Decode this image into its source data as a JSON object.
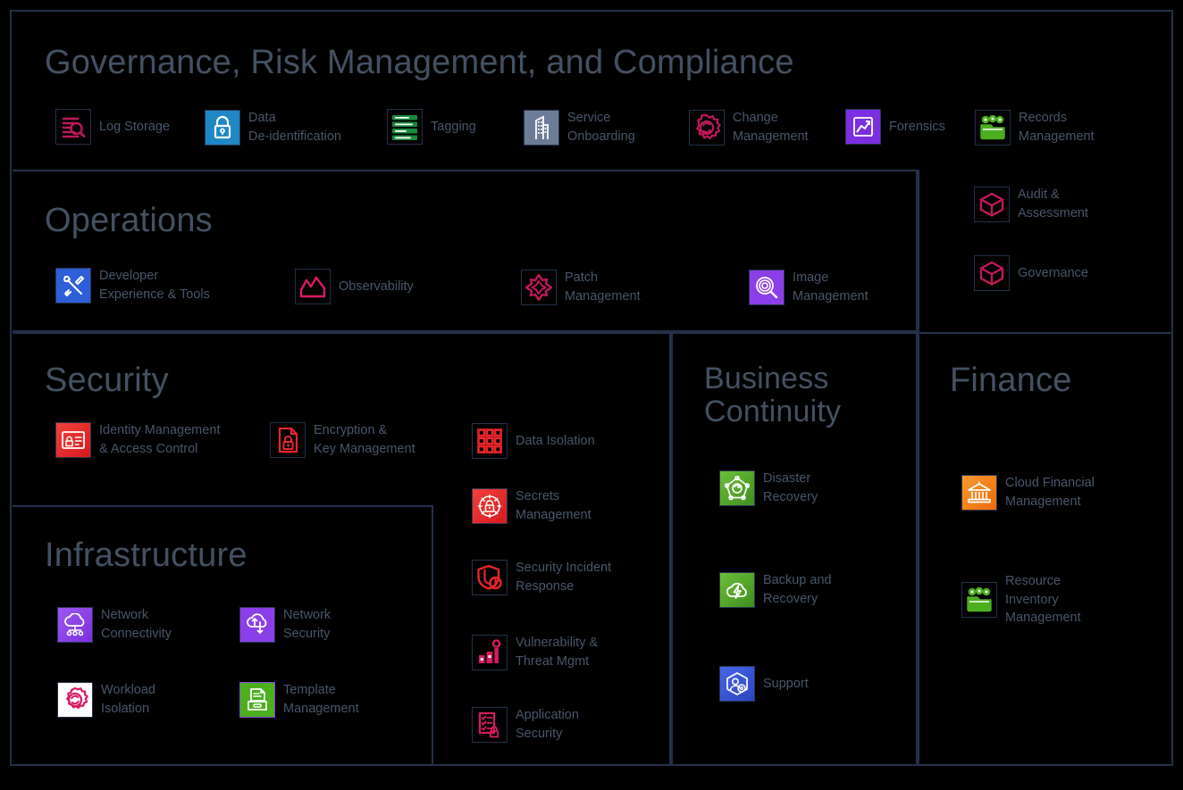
{
  "diagram": {
    "type": "cloud-operating-model-capability-map",
    "sections": [
      {
        "id": "grc",
        "title": "Governance, Risk Management, and Compliance",
        "items": [
          {
            "label": "Log Storage",
            "icon": "log-storage-icon",
            "color": "#C2185B",
            "style": "outline"
          },
          {
            "label": "Data\nDe-identification",
            "icon": "data-deidentification-icon",
            "color": "#1E88C7",
            "style": "filled"
          },
          {
            "label": "Tagging",
            "icon": "tagging-icon",
            "color": "#1B8A3C",
            "style": "outline"
          },
          {
            "label": "Service\nOnboarding",
            "icon": "service-onboarding-icon",
            "color": "#6B7C99",
            "style": "filled"
          },
          {
            "label": "Change\nManagement",
            "icon": "change-management-icon",
            "color": "#C2185B",
            "style": "outline"
          },
          {
            "label": "Forensics",
            "icon": "forensics-icon",
            "color": "#7B2FE0",
            "style": "filled"
          },
          {
            "label": "Records\nManagement",
            "icon": "records-management-icon",
            "color": "#4CAF1E",
            "style": "outline"
          }
        ]
      },
      {
        "id": "operations",
        "title": "Operations",
        "items": [
          {
            "label": "Developer\nExperience & Tools",
            "icon": "developer-tools-icon",
            "color": "#2E5FD9",
            "style": "filled"
          },
          {
            "label": "Observability",
            "icon": "observability-icon",
            "color": "#D81B60",
            "style": "outline"
          },
          {
            "label": "Patch\nManagement",
            "icon": "patch-management-icon",
            "color": "#C2185B",
            "style": "outline"
          },
          {
            "label": "Image\nManagement",
            "icon": "image-management-icon",
            "color": "#8A3FE8",
            "style": "filled"
          }
        ]
      },
      {
        "id": "grc-side",
        "title": "",
        "items": [
          {
            "label": "Audit &\nAssessment",
            "icon": "audit-assessment-icon",
            "color": "#C2185B",
            "style": "outline"
          },
          {
            "label": "Governance",
            "icon": "governance-icon",
            "color": "#C2185B",
            "style": "outline"
          }
        ]
      },
      {
        "id": "security",
        "title": "Security",
        "items": [
          {
            "label": "Identity Management\n& Access Control",
            "icon": "identity-access-icon",
            "color": "#E8262A",
            "style": "filled"
          },
          {
            "label": "Encryption &\nKey Management",
            "icon": "encryption-key-icon",
            "color": "#E8262A",
            "style": "outline"
          },
          {
            "label": "Data Isolation",
            "icon": "data-isolation-icon",
            "color": "#E8262A",
            "style": "outline"
          },
          {
            "label": "Secrets\nManagement",
            "icon": "secrets-management-icon",
            "color": "#E8262A",
            "style": "filled"
          },
          {
            "label": "Security Incident\nResponse",
            "icon": "incident-response-icon",
            "color": "#E8262A",
            "style": "outline"
          },
          {
            "label": "Vulnerability &\nThreat Mgmt",
            "icon": "vulnerability-threat-icon",
            "color": "#D81B60",
            "style": "outline"
          },
          {
            "label": "Application\nSecurity",
            "icon": "application-security-icon",
            "color": "#D81B60",
            "style": "outline"
          }
        ]
      },
      {
        "id": "infrastructure",
        "title": "Infrastructure",
        "items": [
          {
            "label": "Network\nConnectivity",
            "icon": "network-connectivity-icon",
            "color": "#8A3FE8",
            "style": "filled"
          },
          {
            "label": "Network\nSecurity",
            "icon": "network-security-icon",
            "color": "#8A3FE8",
            "style": "filled"
          },
          {
            "label": "Workload\nIsolation",
            "icon": "workload-isolation-icon",
            "color": "#D81B60",
            "style": "outline-white"
          },
          {
            "label": "Template\nManagement",
            "icon": "template-management-icon",
            "color": "#4CAF1E",
            "style": "filled"
          }
        ]
      },
      {
        "id": "business-continuity",
        "title": "Business\nContinuity",
        "items": [
          {
            "label": "Disaster\nRecovery",
            "icon": "disaster-recovery-icon",
            "color": "#4CA327",
            "style": "filled"
          },
          {
            "label": "Backup and\nRecovery",
            "icon": "backup-recovery-icon",
            "color": "#4CA327",
            "style": "filled"
          },
          {
            "label": "Support",
            "icon": "support-icon",
            "color": "#3451D1",
            "style": "filled"
          }
        ]
      },
      {
        "id": "finance",
        "title": "Finance",
        "items": [
          {
            "label": "Cloud Financial\nManagement",
            "icon": "cloud-financial-icon",
            "color": "#F27A12",
            "style": "filled"
          },
          {
            "label": "Resource\nInventory\nManagement",
            "icon": "resource-inventory-icon",
            "color": "#4CAF1E",
            "style": "outline"
          }
        ]
      }
    ],
    "colors": {
      "background": "#000000",
      "border": "#24304a",
      "title_text": "#445163",
      "label_text": "#48566b"
    }
  }
}
